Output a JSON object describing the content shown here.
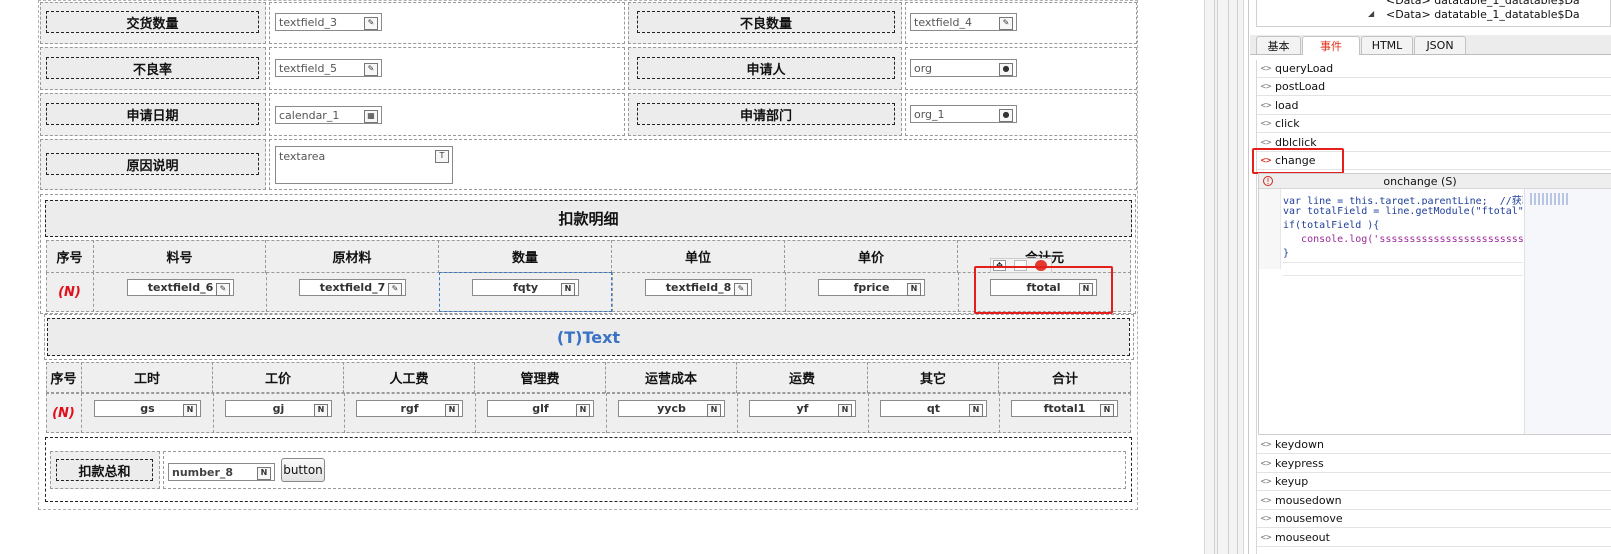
{
  "form": {
    "rows": [
      {
        "l1": "交货数量",
        "f1": "textfield_3",
        "l2": "不良数量",
        "f2": "textfield_4"
      },
      {
        "l1": "不良率",
        "f1": "textfield_5",
        "l2": "申请人",
        "f2": "org"
      },
      {
        "l1": "申请日期",
        "f1": "calendar_1",
        "l2": "申请部门",
        "f2": "org_1"
      }
    ],
    "reason_label": "原因说明",
    "reason_field": "textarea"
  },
  "table1": {
    "title": "扣款明细",
    "headers": [
      "序号",
      "料号",
      "原材料",
      "数量",
      "单位",
      "单价",
      "合计元"
    ],
    "row_marker": "(N)",
    "fields": [
      "textfield_6",
      "textfield_7",
      "fqty",
      "textfield_8",
      "fprice",
      "ftotal"
    ]
  },
  "text_block": "(T)Text",
  "table2": {
    "headers": [
      "序号",
      "工时",
      "工价",
      "人工费",
      "管理费",
      "运营成本",
      "运费",
      "其它",
      "合计"
    ],
    "row_marker": "(N)",
    "fields": [
      "gs",
      "gj",
      "rgf",
      "glf",
      "yycb",
      "yf",
      "qt",
      "ftotal1"
    ]
  },
  "summary": {
    "label": "扣款总和",
    "field": "number_8",
    "button": "button"
  },
  "panel": {
    "tree": [
      "<Data> datatable_1_datatable$Da",
      "<Data> datatable_1_datatable$Da"
    ],
    "tabs": [
      "基本",
      "事件",
      "HTML",
      "JSON"
    ],
    "active_tab": "事件",
    "events_top": [
      "queryLoad",
      "postLoad",
      "load",
      "click",
      "dblclick",
      "change"
    ],
    "selected_event": "change",
    "editor_title": "onchange (S)",
    "code": [
      "var line = this.target.parentLine;  //获取",
      "var totalField = line.getModule(\"ftotal\");",
      "if(totalField ){",
      "   console.log('ssssssssssssssssssssssss",
      "}"
    ],
    "events_bottom": [
      "keydown",
      "keypress",
      "keyup",
      "mousedown",
      "mousemove",
      "mouseout"
    ]
  },
  "colors": {
    "accent_red": "#e5201c",
    "tab_active": "#e0301c",
    "text_blue": "#3a72c4"
  }
}
